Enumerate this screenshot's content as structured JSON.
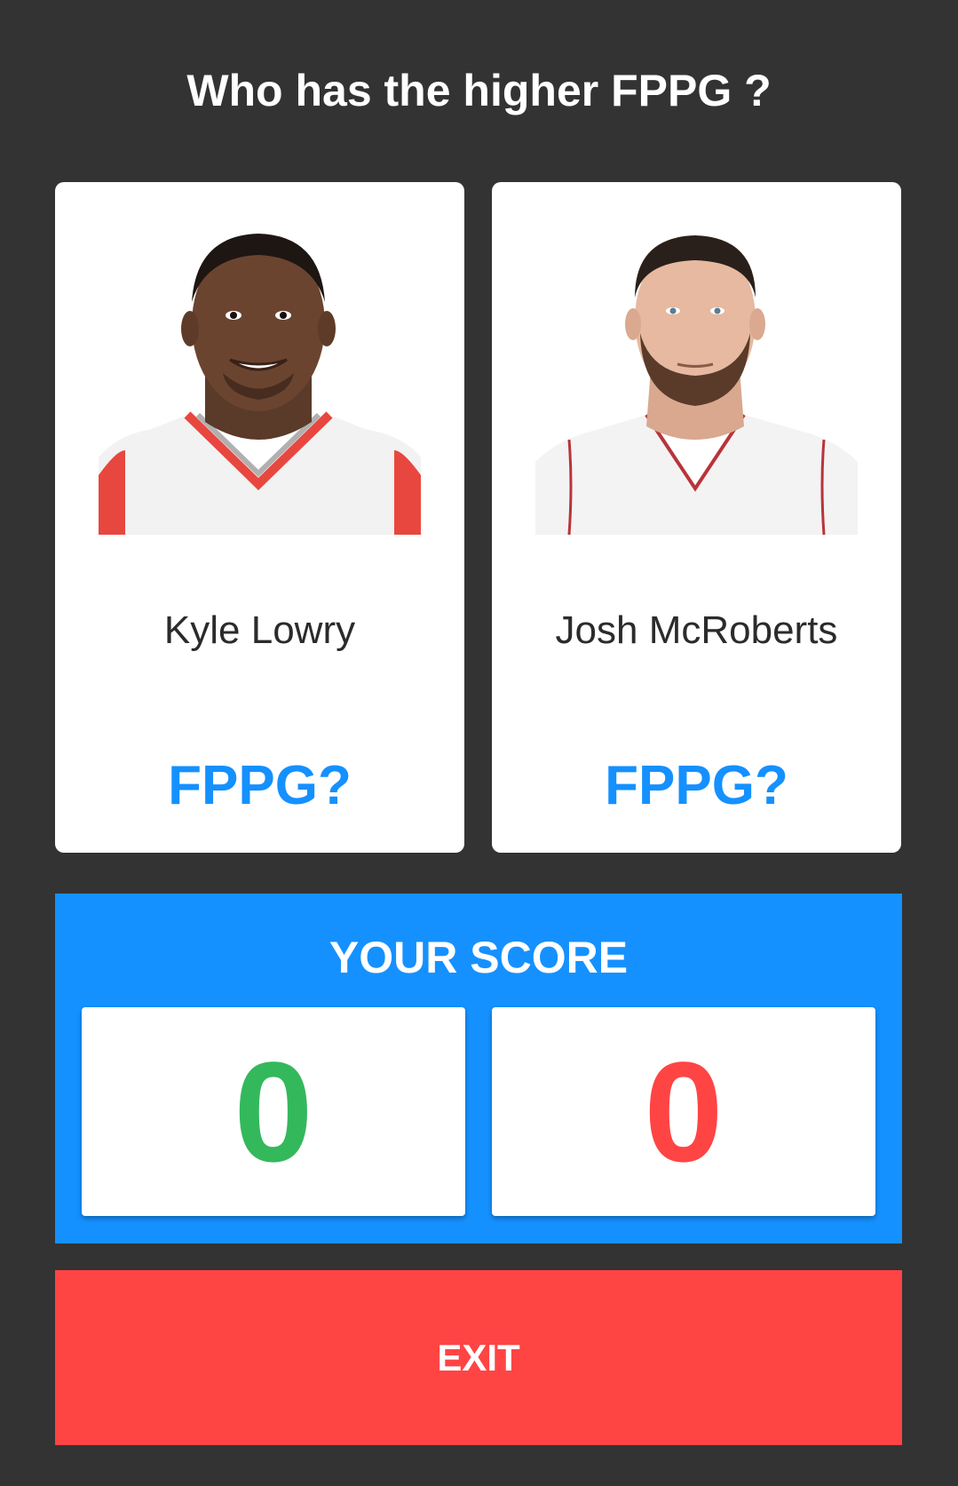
{
  "question": "Who has the higher FPPG ?",
  "players": [
    {
      "name": "Kyle Lowry",
      "fppg_label": "FPPG?",
      "jersey_trim_color": "#e8473f"
    },
    {
      "name": "Josh McRoberts",
      "fppg_label": "FPPG?",
      "jersey_trim_color": "#b8343a"
    }
  ],
  "score": {
    "title": "YOUR SCORE",
    "correct": "0",
    "wrong": "0"
  },
  "exit_label": "EXIT",
  "colors": {
    "background": "#333333",
    "accent_blue": "#1591ff",
    "correct_green": "#34b85c",
    "wrong_red": "#ff4444"
  }
}
